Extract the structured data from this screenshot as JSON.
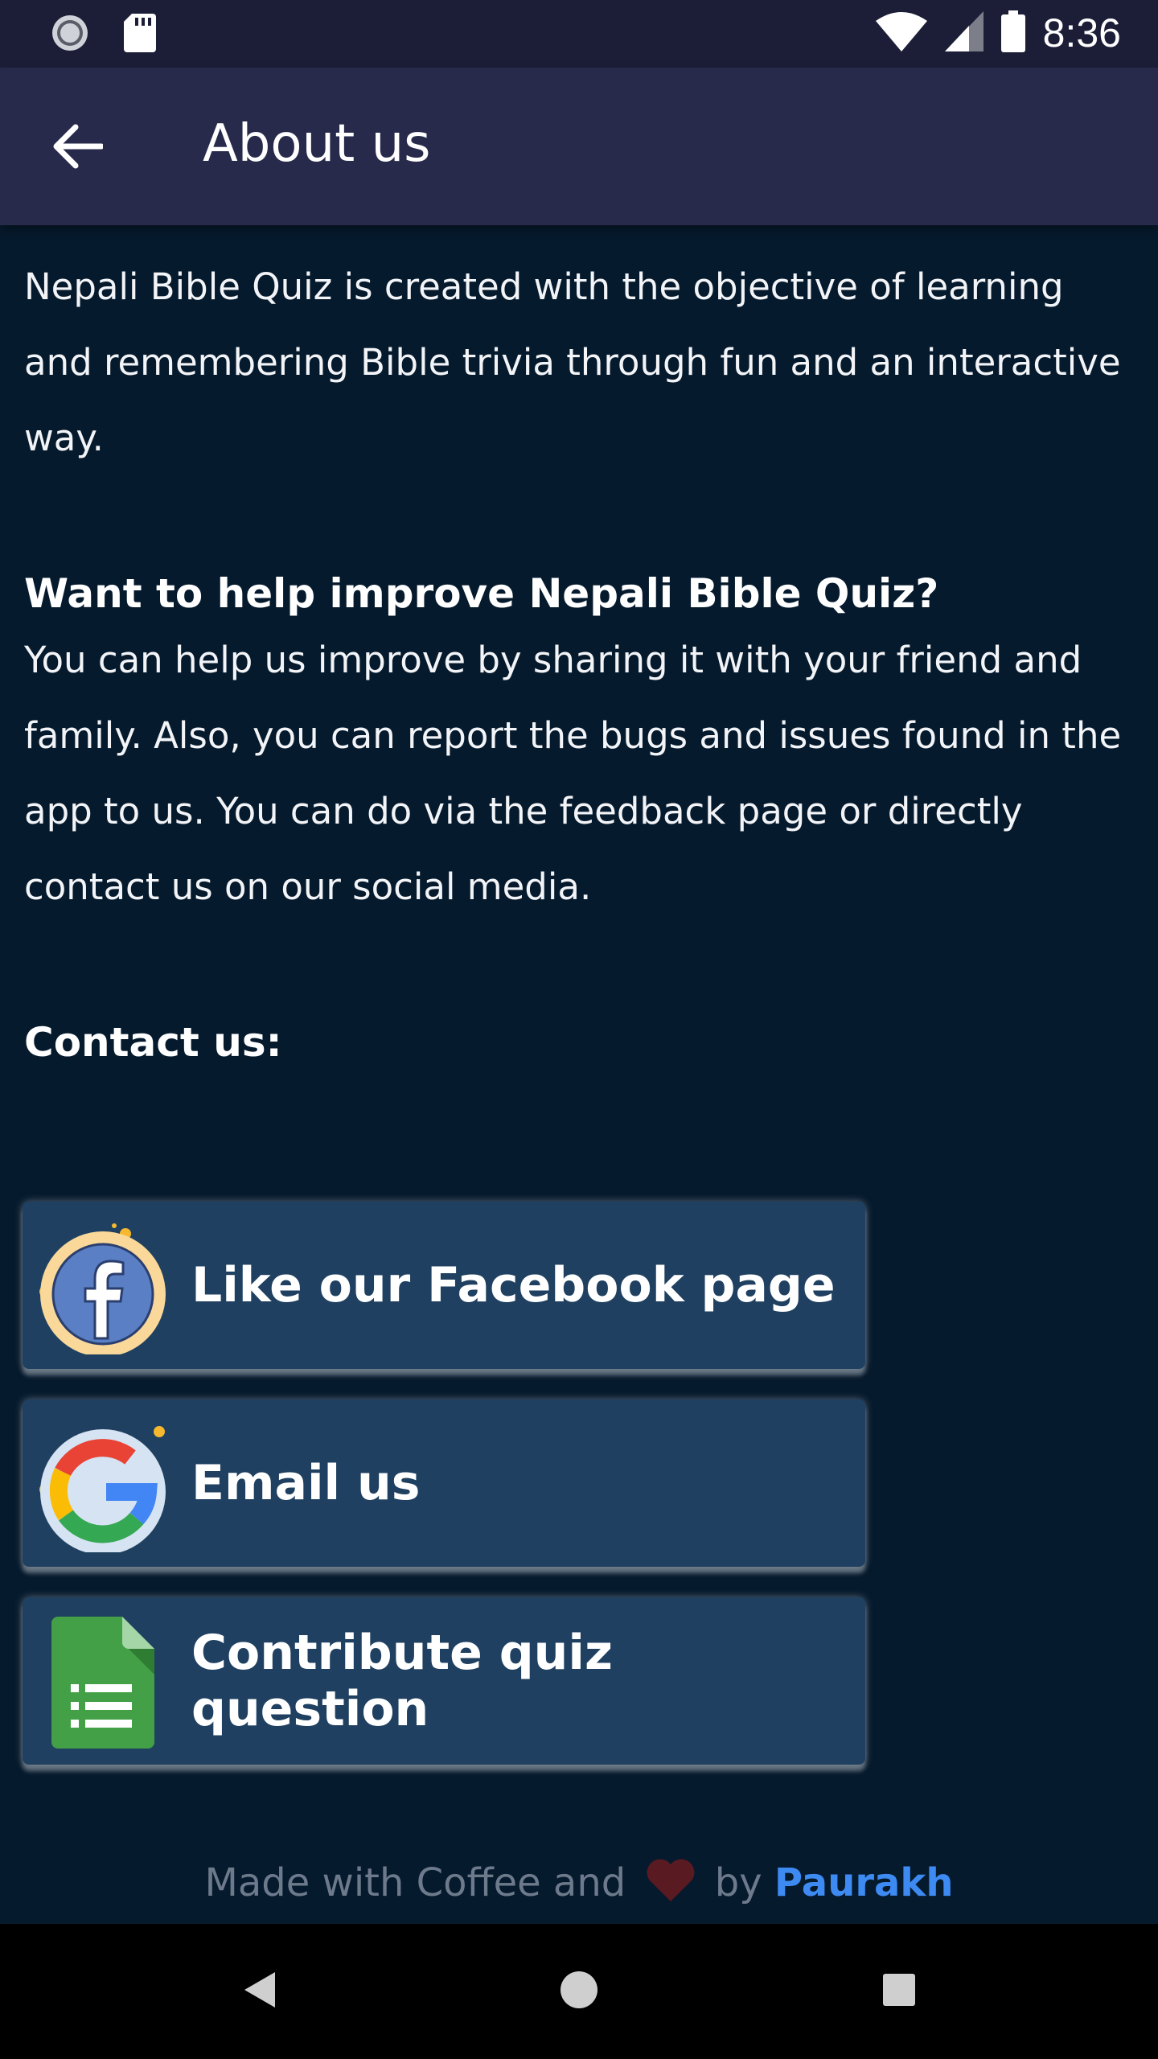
{
  "status_bar": {
    "time": "8:36",
    "icons": [
      "sync-icon",
      "sd-card-icon",
      "wifi-icon",
      "signal-icon",
      "battery-icon"
    ]
  },
  "app_bar": {
    "title": "About us",
    "back_icon": "arrow-back-icon"
  },
  "about": {
    "intro": "Nepali Bible Quiz is created with the objective of learning and remembering Bible trivia through fun and an interactive way.",
    "help_heading": "Want to help improve Nepali Bible Quiz?",
    "help_text": "You can help us improve by sharing it with your friend and family. Also, you can report the bugs and issues found in the app to us. You can do via the feedback page or directly contact us on our social media.",
    "contact_heading": "Contact us:"
  },
  "contact_buttons": [
    {
      "label": "Like our Facebook page",
      "icon": "facebook-icon"
    },
    {
      "label": "Email us",
      "icon": "google-icon"
    },
    {
      "label": "Contribute quiz question",
      "icon": "google-sheets-icon"
    }
  ],
  "footer": {
    "prefix": "Made with Coffee and",
    "by": "by",
    "author": "Paurakh",
    "heart_icon": "heart-icon"
  },
  "nav_bar": {
    "icons": [
      "back-triangle-icon",
      "home-circle-icon",
      "recents-square-icon"
    ]
  },
  "colors": {
    "background": "#061a2d",
    "app_bar": "#272a4a",
    "card": "#1f4060",
    "accent_author": "#3d8bf2"
  }
}
